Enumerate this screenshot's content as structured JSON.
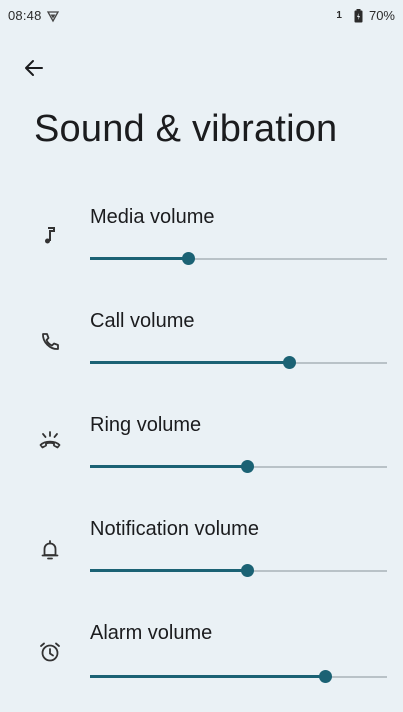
{
  "status_bar": {
    "time": "08:48",
    "sim": "1",
    "battery": "70%"
  },
  "header": {
    "title": "Sound & vibration"
  },
  "accent_color": "#1b6274",
  "volumes": [
    {
      "label": "Media volume",
      "icon": "music-note-icon",
      "level": 0.33
    },
    {
      "label": "Call volume",
      "icon": "phone-icon",
      "level": 0.67
    },
    {
      "label": "Ring volume",
      "icon": "ringing-phone-icon",
      "level": 0.53
    },
    {
      "label": "Notification volume",
      "icon": "bell-icon",
      "level": 0.53
    },
    {
      "label": "Alarm volume",
      "icon": "alarm-clock-icon",
      "level": 0.79
    }
  ]
}
